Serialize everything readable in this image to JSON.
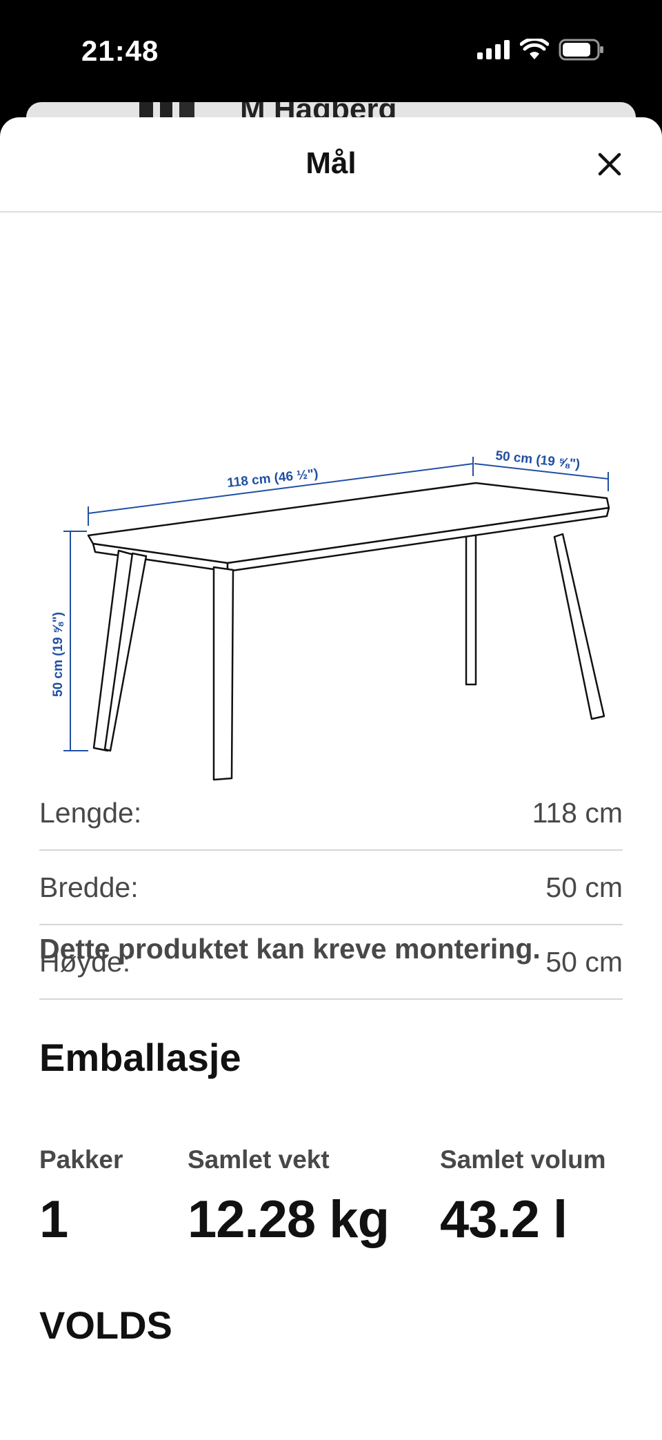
{
  "status_bar": {
    "time": "21:48"
  },
  "background_page": {
    "title": "M Hagberg"
  },
  "modal": {
    "title": "Mål",
    "close_icon": "close-icon"
  },
  "diagram": {
    "length_label": "118 cm (46 ½\")",
    "width_label": "50 cm (19 ⅝\")",
    "height_label": "50 cm (19 ⅝\")"
  },
  "dimensions": [
    {
      "label": "Lengde:",
      "value": "118 cm"
    },
    {
      "label": "Bredde:",
      "value": "50 cm"
    },
    {
      "label": "Høyde:",
      "value": "50 cm"
    }
  ],
  "assembly_note": "Dette produktet kan kreve montering.",
  "packaging": {
    "title": "Emballasje",
    "packages_label": "Pakker",
    "packages_value": "1",
    "weight_label": "Samlet vekt",
    "weight_value": "12.28 kg",
    "volume_label": "Samlet volum",
    "volume_value": "43.2 l"
  },
  "next_section_title": "VOLDS"
}
